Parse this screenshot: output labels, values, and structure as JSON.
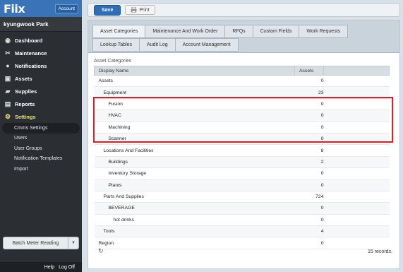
{
  "app": {
    "logo": "Fiix",
    "account_label": "Account",
    "user": "kyungwook Park"
  },
  "nav": [
    {
      "label": "Dashboard",
      "icon": "globe-icon",
      "glyph": "◉"
    },
    {
      "label": "Maintenance",
      "icon": "tools-icon",
      "glyph": "✂"
    },
    {
      "label": "Notifications",
      "icon": "chat-icon",
      "glyph": "●"
    },
    {
      "label": "Assets",
      "icon": "box-icon",
      "glyph": "▣"
    },
    {
      "label": "Supplies",
      "icon": "truck-icon",
      "glyph": "▰"
    },
    {
      "label": "Reports",
      "icon": "report-icon",
      "glyph": "▤"
    },
    {
      "label": "Settings",
      "icon": "gear-icon",
      "glyph": "⚙"
    }
  ],
  "settings_sub": [
    "Cmms Settings",
    "Users",
    "User Groups",
    "Notification Templates",
    "Import"
  ],
  "batch_label": "Batch Meter Reading",
  "footer": {
    "help": "Help",
    "logoff": "Log Off"
  },
  "toolbar": {
    "save": "Save",
    "print": "Print"
  },
  "tabs_row1": [
    "Asset Categories",
    "Maintenance And Work Order",
    "RFQs",
    "Custom Fields",
    "Work Requests"
  ],
  "tabs_row2": [
    "Lookup Tables",
    "Audit Log",
    "Account Management"
  ],
  "section_title": "Asset Categories",
  "table": {
    "headers": [
      "Display Name",
      "Assets"
    ],
    "rows": [
      {
        "name": "Assets",
        "count": "0",
        "indent": 0
      },
      {
        "name": "Equipment",
        "count": "23",
        "indent": 1
      },
      {
        "name": "Fusion",
        "count": "0",
        "indent": 2
      },
      {
        "name": "HVAC",
        "count": "0",
        "indent": 2
      },
      {
        "name": "Machining",
        "count": "0",
        "indent": 2
      },
      {
        "name": "Scanner",
        "count": "0",
        "indent": 2
      },
      {
        "name": "Locations And Facilities",
        "count": "8",
        "indent": 1
      },
      {
        "name": "Buildings",
        "count": "2",
        "indent": 2
      },
      {
        "name": "Inventory Storage",
        "count": "0",
        "indent": 2
      },
      {
        "name": "Plants",
        "count": "0",
        "indent": 2
      },
      {
        "name": "Parts And Supplies",
        "count": "724",
        "indent": 1
      },
      {
        "name": "BEVERAGE",
        "count": "0",
        "indent": 2
      },
      {
        "name": "hot drinks",
        "count": "0",
        "indent": 3
      },
      {
        "name": "Tools",
        "count": "4",
        "indent": 1
      },
      {
        "name": "Region",
        "count": "0",
        "indent": 0
      }
    ]
  },
  "records": "15 records."
}
